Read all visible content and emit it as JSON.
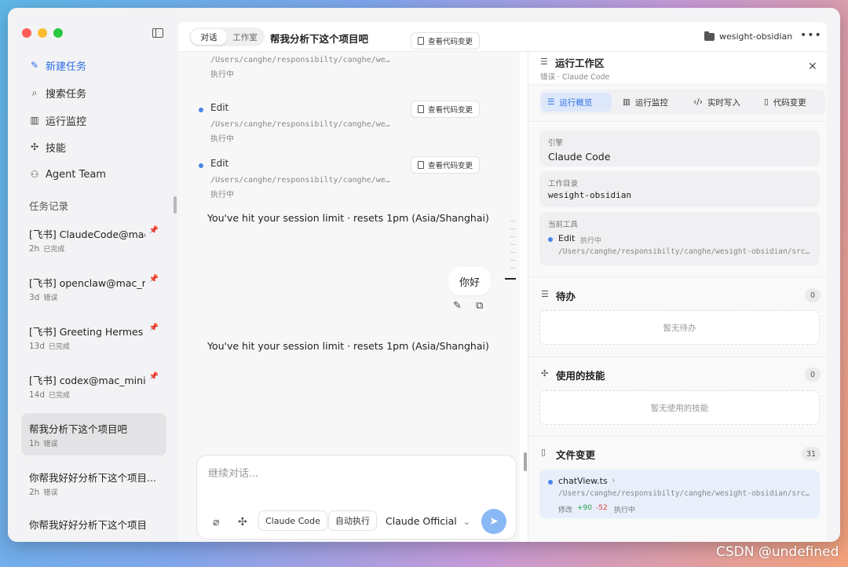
{
  "sidebar": {
    "nav": [
      {
        "label": "新建任务",
        "icon": "edit-icon"
      },
      {
        "label": "搜索任务",
        "icon": "search-icon"
      },
      {
        "label": "运行监控",
        "icon": "chart-icon"
      },
      {
        "label": "技能",
        "icon": "puzzle-icon"
      },
      {
        "label": "Agent Team",
        "icon": "team-icon"
      }
    ],
    "section_label": "任务记录",
    "tasks": [
      {
        "title": "[飞书] ClaudeCode@mac_",
        "age": "2h",
        "status": "已完成"
      },
      {
        "title": "[飞书] openclaw@mac_mi",
        "age": "3d",
        "status": "错误"
      },
      {
        "title": "[飞书] Greeting Hermes A",
        "age": "13d",
        "status": "已完成"
      },
      {
        "title": "[飞书] codex@mac_mini",
        "age": "14d",
        "status": "已完成"
      },
      {
        "title": "帮我分析下这个项目吧",
        "age": "1h",
        "status": "错误"
      },
      {
        "title": "你帮我好好分析下这个项目...",
        "age": "2h",
        "status": "错误"
      },
      {
        "title": "你帮我好好分析下这个项目",
        "age": "",
        "status": ""
      }
    ]
  },
  "topbar": {
    "tab_chat": "对话",
    "tab_studio": "工作室",
    "title": "帮我分析下这个项目吧",
    "folder": "wesight-obsidian",
    "more": "•••"
  },
  "chat": {
    "tools": [
      {
        "name": "",
        "path": "/Users/canghe/responsibilty/canghe/we…",
        "state": "执行中",
        "button": "查看代码变更"
      },
      {
        "name": "Edit",
        "path": "/Users/canghe/responsibilty/canghe/we…",
        "state": "执行中",
        "button": "查看代码变更"
      },
      {
        "name": "Edit",
        "path": "/Users/canghe/responsibilty/canghe/we…",
        "state": "执行中",
        "button": "查看代码变更"
      }
    ],
    "system_msg_1": "You've hit your session limit · resets 1pm (Asia/Shanghai)",
    "user_msg": "你好",
    "system_msg_2": "You've hit your session limit · resets 1pm (Asia/Shanghai)",
    "composer": {
      "placeholder": "继续对话...",
      "engine_chip": "Claude Code",
      "mode_chip": "自动执行",
      "model": "Claude Official"
    }
  },
  "panel": {
    "title": "运行工作区",
    "subtitle": "错误 · Claude Code",
    "tabs": [
      "运行概览",
      "运行监控",
      "实时写入",
      "代码变更"
    ],
    "engine_label": "引擎",
    "engine_value": "Claude Code",
    "dir_label": "工作目录",
    "dir_value": "wesight-obsidian",
    "tool_label": "当前工具",
    "tool_name": "Edit",
    "tool_state": "执行中",
    "tool_path": "/Users/canghe/responsibilty/canghe/wesight-obsidian/src…",
    "todo_title": "待办",
    "todo_count": "0",
    "todo_empty": "暂无待办",
    "skills_title": "使用的技能",
    "skills_count": "0",
    "skills_empty": "暂无使用的技能",
    "files_title": "文件变更",
    "files_count": "31",
    "file_name": "chatView.ts",
    "file_path": "/Users/canghe/responsibilty/canghe/wesight-obsidian/src…",
    "file_change_label": "修改",
    "file_added": "+90",
    "file_removed": "-52",
    "file_state": "执行中"
  },
  "watermark": "CSDN @undefined"
}
